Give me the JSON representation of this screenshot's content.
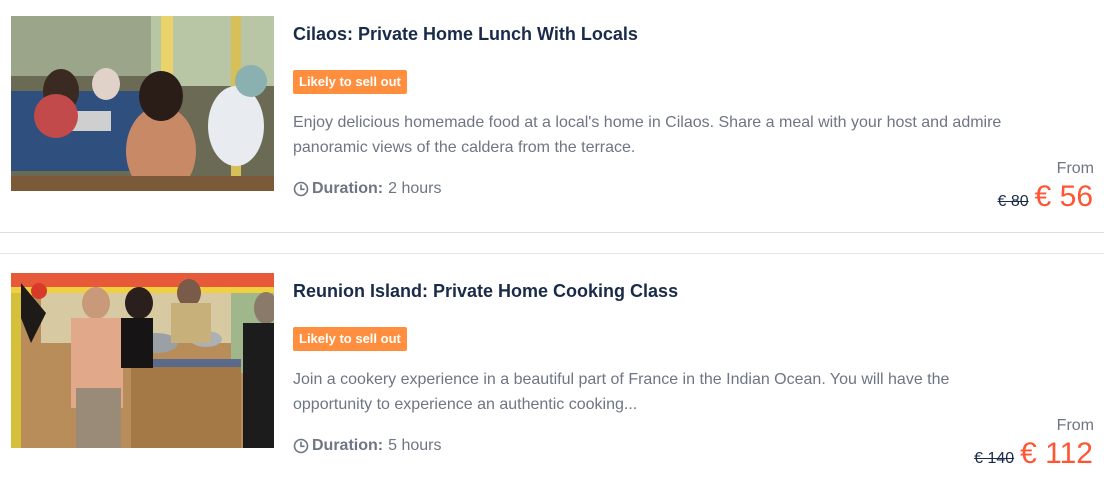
{
  "activities": [
    {
      "title": "Cilaos: Private Home Lunch With Locals",
      "badge": "Likely to sell out",
      "description": "Enjoy delicious homemade food at a local's home in Cilaos. Share a meal with your host and admire panoramic views of the caldera from the terrace.",
      "duration_label": "Duration:",
      "duration_value": "2 hours",
      "from_label": "From",
      "old_price": "€ 80",
      "price": "€ 56"
    },
    {
      "title": "Reunion Island: Private Home Cooking Class",
      "badge": "Likely to sell out",
      "description": "Join a cookery experience in a beautiful part of France in the Indian Ocean. You will have the opportunity to experience an authentic cooking...",
      "duration_label": "Duration:",
      "duration_value": "5 hours",
      "from_label": "From",
      "old_price": "€ 140",
      "price": "€ 112"
    }
  ],
  "icons": {
    "duration": "clock-icon"
  },
  "colors": {
    "badge": "#ff8f3f",
    "price": "#ff5533",
    "title": "#1a2b49",
    "muted": "#6e7583"
  }
}
